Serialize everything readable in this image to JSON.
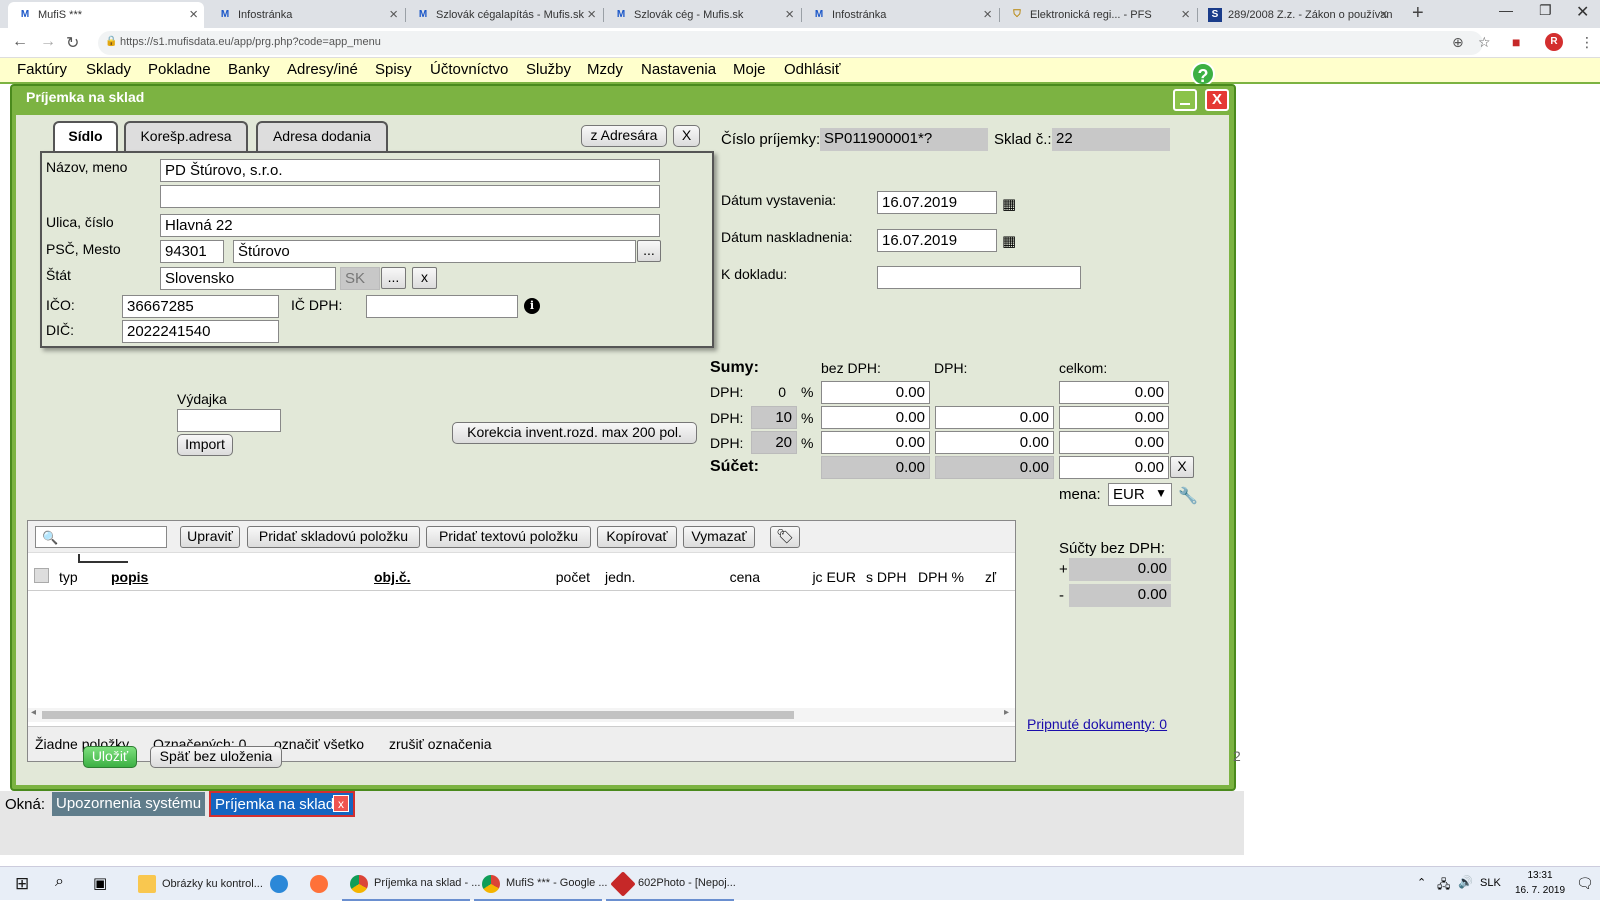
{
  "browser": {
    "tabs": [
      {
        "title": "MufiS ***",
        "fav": "M"
      },
      {
        "title": "Infostránka",
        "fav": "M"
      },
      {
        "title": "Szlovák cégalapítás - Mufis.sk",
        "fav": "M"
      },
      {
        "title": "Szlovák cég - Mufis.sk",
        "fav": "M"
      },
      {
        "title": "Infostránka",
        "fav": "M"
      },
      {
        "title": "Elektronická regi... - PFS",
        "fav": "⛉"
      },
      {
        "title": "289/2008 Z.z. - Zákon o používan",
        "fav": "S"
      }
    ],
    "url": "https://s1.mufisdata.eu/app/prg.php?code=app_menu",
    "profile_initial": "R"
  },
  "menu": [
    "Faktúry",
    "Sklady",
    "Pokladne",
    "Banky",
    "Adresy/iné",
    "Spisy",
    "Účtovníctvo",
    "Služby",
    "Mzdy",
    "Nastavenia",
    "Moje",
    "Odhlásiť"
  ],
  "window": {
    "title": "Príjemka na sklad",
    "close_label": "X"
  },
  "address": {
    "tabs": [
      "Sídlo",
      "Korešp.adresa",
      "Adresa dodania"
    ],
    "from_address_btn": "z Adresára",
    "clear_btn": "X",
    "name_label": "Názov, meno",
    "name1": "PD Štúrovo, s.r.o.",
    "name2": "",
    "street_label": "Ulica, číslo",
    "street": "Hlavná 22",
    "zip_city_label": "PSČ, Mesto",
    "zip": "94301",
    "city": "Štúrovo",
    "dots": "...",
    "state_label": "Štát",
    "state": "Slovensko",
    "state_code": "SK",
    "state_x": "x",
    "ico_label": "IČO:",
    "ico": "36667285",
    "icdph_label": "IČ DPH:",
    "icdph": "",
    "dic_label": "DIČ:",
    "dic": "2022241540"
  },
  "doc": {
    "number_label": "Číslo príjemky:",
    "number": "SP011900001*?",
    "store_label": "Sklad č.:",
    "store": "22",
    "issue_label": "Dátum vystavenia:",
    "issue_date": "16.07.2019",
    "stock_label": "Dátum naskladnenia:",
    "stock_date": "16.07.2019",
    "ref_label": "K dokladu:",
    "ref_value": ""
  },
  "vydajka": {
    "label": "Výdajka",
    "value": "",
    "import_btn": "Import"
  },
  "correction_btn": "Korekcia invent.rozd. max 200 pol.",
  "sums": {
    "title": "Sumy:",
    "col_base": "bez DPH:",
    "col_vat": "DPH:",
    "col_total": "celkom:",
    "row_label": "DPH:",
    "pct": "%",
    "rates": [
      "0",
      "10",
      "20"
    ],
    "base": [
      "0.00",
      "0.00",
      "0.00"
    ],
    "vat": [
      "",
      "0.00",
      "0.00"
    ],
    "total": [
      "0.00",
      "0.00",
      "0.00"
    ],
    "sum_label": "Súčet:",
    "sum_base": "0.00",
    "sum_vat": "0.00",
    "sum_total": "0.00",
    "sum_x": "X",
    "currency_label": "mena:",
    "currency": "EUR"
  },
  "grid": {
    "buttons": [
      "Upraviť",
      "Pridať skladovú položku",
      "Pridať textovú položku",
      "Kopírovať",
      "Vymazať"
    ],
    "columns": [
      "typ",
      "popis",
      "obj.č.",
      "počet",
      "jedn.",
      "cena",
      "jc EUR",
      "s DPH",
      "DPH %",
      "zľ"
    ],
    "no_items": "Žiadne položky",
    "marked": "Označených: 0",
    "mark_all": "označiť všetko",
    "unmark": "zrušiť označenia"
  },
  "side": {
    "sums_label": "Súčty bez DPH:",
    "plus": "+",
    "plus_val": "0.00",
    "minus": "-",
    "minus_val": "0.00",
    "attached": "Pripnuté dokumenty: 0",
    "edge_char": "2"
  },
  "actions": {
    "save": "Uložiť",
    "back": "Späť bez uloženia"
  },
  "windows_bar": {
    "label": "Okná:",
    "item1": "Upozornenia systému",
    "item2": "Príjemka na sklad",
    "item2_close": "x"
  },
  "taskbar": {
    "apps": [
      "Obrázky ku kontrol...",
      "Príjemka na sklad - ...",
      "MufiS *** - Google ...",
      "602Photo - [Nepoj..."
    ],
    "lang": "SLK",
    "time": "13:31",
    "date": "16. 7. 2019"
  }
}
